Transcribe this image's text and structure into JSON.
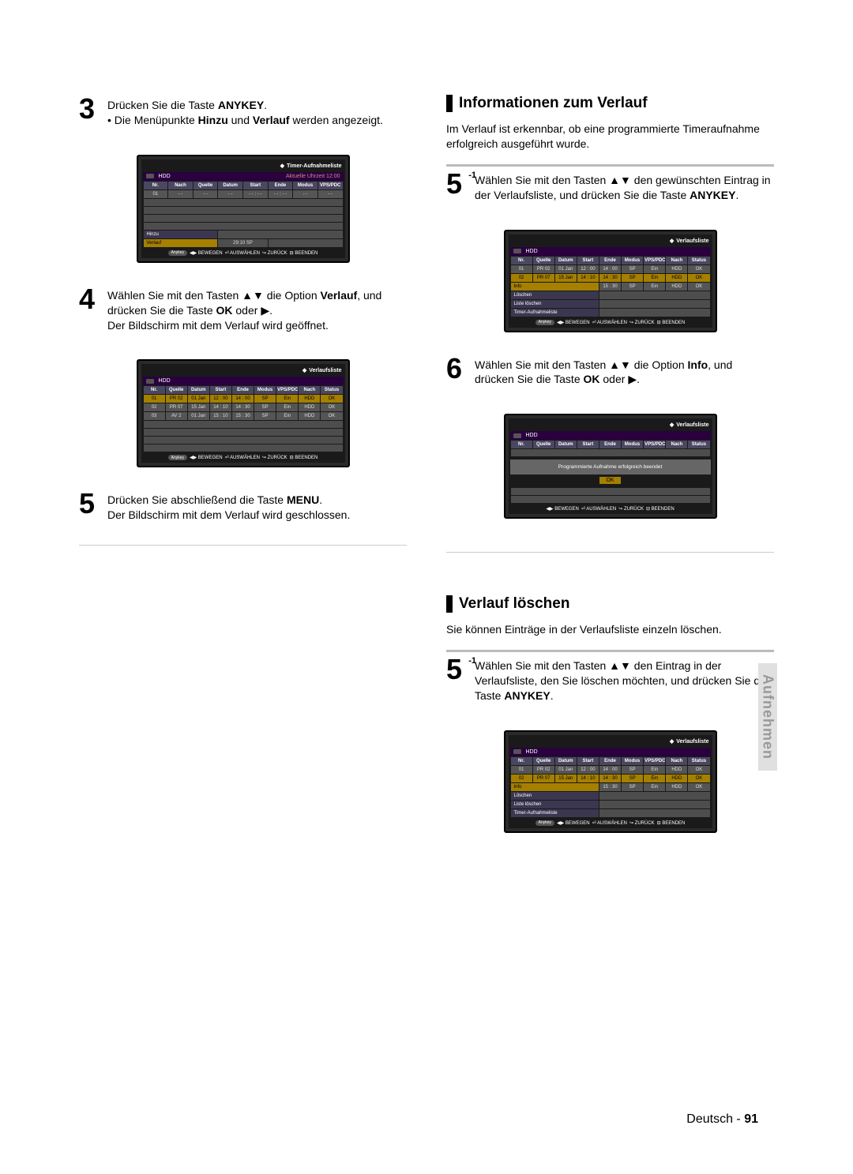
{
  "side_tab": "Aufnehmen",
  "footer_lang": "Deutsch",
  "footer_sep": " - ",
  "footer_page": "91",
  "arrows_updown": "▲▼",
  "arrow_right": "▶",
  "left": {
    "step3": {
      "num": "3",
      "line1a": "Drücken Sie die Taste ",
      "line1b": "ANYKEY",
      "line1c": ".",
      "bullet_pre": "• Die Menüpunkte ",
      "b1": "Hinzu",
      "mid": " und ",
      "b2": "Verlauf",
      "post": " werden angezeigt."
    },
    "step4": {
      "num": "4",
      "pre": "Wählen Sie mit den Tasten ",
      "mid": " die Option ",
      "opt": "Verlauf",
      "post1": ", und drücken Sie die Taste ",
      "ok": "OK",
      "post2": " oder ",
      "line2": "Der Bildschirm mit dem Verlauf wird geöffnet."
    },
    "step5": {
      "num": "5",
      "pre": "Drücken Sie abschließend die Taste ",
      "menu": "MENU",
      "post": ".",
      "line2": "Der Bildschirm mit dem Verlauf wird geschlossen."
    }
  },
  "right": {
    "sec1_title": "Informationen zum Verlauf",
    "sec1_para": "Im Verlauf ist erkennbar, ob eine programmierte Timeraufnahme erfolgreich ausgeführt wurde.",
    "step5b": {
      "num": "5",
      "sup": "-1",
      "pre": "Wählen Sie mit den Tasten ",
      "mid": " den gewünschten Eintrag in der Verlaufsliste, und drücken Sie die Taste ",
      "any": "ANYKEY",
      "post": "."
    },
    "step6": {
      "num": "6",
      "pre": "Wählen Sie mit den Tasten ",
      "mid": " die Option ",
      "opt": "Info",
      "post": ", und drücken Sie die Taste ",
      "ok": "OK",
      "post2": " oder "
    },
    "sec2_title": "Verlauf löschen",
    "sec2_para": "Sie können Einträge in der Verlaufsliste einzeln löschen.",
    "step5c": {
      "num": "5",
      "sup": "-1",
      "pre": "Wählen Sie mit den Tasten ",
      "mid": " den Eintrag in der Verlaufsliste, den Sie löschen möchten, und drücken Sie die Taste ",
      "any": "ANYKEY",
      "post": "."
    }
  },
  "ui": {
    "timer_title": "Timer-Aufnahmeliste",
    "verlauf_title": "Verlaufsliste",
    "hdd": "HDD",
    "clock": "Aktuelle Uhrzeit 12:00",
    "headers_timer": [
      "Nr.",
      "Nach",
      "Quelle",
      "Datum",
      "Start",
      "Ende",
      "Modus",
      "VPS/PDC"
    ],
    "headers_hist": [
      "Nr.",
      "Quelle",
      "Datum",
      "Start",
      "Ende",
      "Modus",
      "VPS/PDC",
      "Nach",
      "Status"
    ],
    "row_num01": "01",
    "dashes": "- -",
    "dash4": "- - : - -",
    "menu_hinzu": "Hinzu",
    "menu_verlauf": "Verlauf",
    "menu_info": "Info",
    "menu_loeschen": "Löschen",
    "menu_liste": "Liste löschen",
    "menu_timer": "Timer-Aufnahmeliste",
    "verlauf_time": "29:10  SP",
    "anykey": "Anykey",
    "foot_bewegen": "◀▶ BEWEGEN",
    "foot_aus": "⏎ AUSWÄHLEN",
    "foot_zur": "↪ ZURÜCK",
    "foot_been": "⊟ BEENDEN",
    "msg": "Programmierte Aufnahme erfolgreich beendet",
    "ok": "OK",
    "hist_rows_left": [
      {
        "nr": "01",
        "q": "PR 02",
        "d": "01 Jan",
        "s": "12 : 00",
        "e": "14 : 00",
        "m": "SP",
        "v": "Ein",
        "n": "HDD",
        "st": "OK"
      },
      {
        "nr": "02",
        "q": "PR 07",
        "d": "15 Jan",
        "s": "14 : 10",
        "e": "14 : 30",
        "m": "SP",
        "v": "Ein",
        "n": "HDD",
        "st": "OK"
      },
      {
        "nr": "03",
        "q": "AV 2",
        "d": "01 Jan",
        "s": "15 : 10",
        "e": "15 : 30",
        "m": "SP",
        "v": "Ein",
        "n": "HDD",
        "st": "OK"
      }
    ],
    "hist_rows_right": [
      {
        "nr": "01",
        "q": "PR 02",
        "d": "01 Jan",
        "s": "12 : 00",
        "e": "14 : 00",
        "m": "SP",
        "v": "Ein",
        "n": "HDD",
        "st": "OK"
      },
      {
        "nr": "02",
        "q": "PR 07",
        "d": "15 Jan",
        "s": "14 : 10",
        "e": "14 : 30",
        "m": "SP",
        "v": "Ein",
        "n": "HDD",
        "st": "OK"
      },
      {
        "nr": "",
        "q": "",
        "d": "",
        "s": "",
        "e": "15 : 30",
        "m": "SP",
        "v": "Ein",
        "n": "HDD",
        "st": "OK"
      }
    ]
  }
}
